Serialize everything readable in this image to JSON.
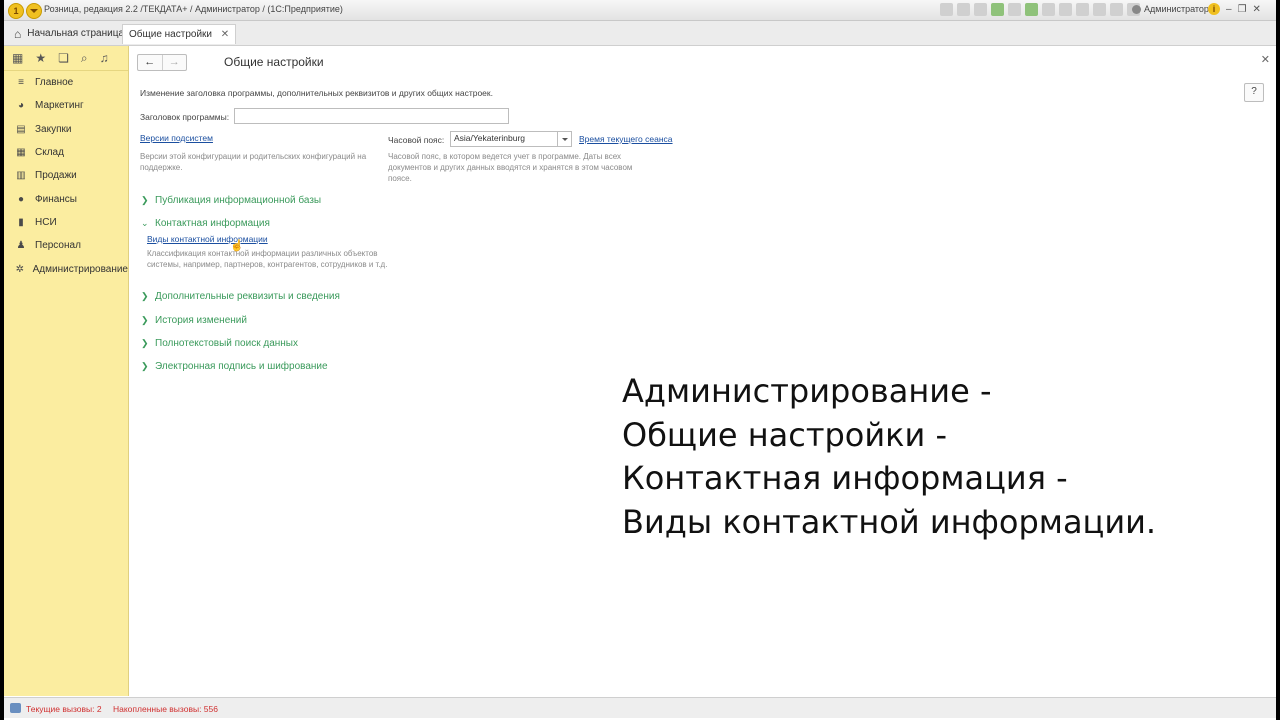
{
  "window": {
    "title": "Розница, редакция 2.2 /ТЕКДАТА+ / Администратор /  (1С:Предприятие)",
    "user": "Администратор"
  },
  "tabs": {
    "home": "Начальная страница",
    "active": "Общие настройки"
  },
  "sidebar": {
    "items": [
      {
        "label": "Главное",
        "icon": "menu-icon"
      },
      {
        "label": "Маркетинг",
        "icon": "pie-chart-icon"
      },
      {
        "label": "Закупки",
        "icon": "purchase-icon"
      },
      {
        "label": "Склад",
        "icon": "warehouse-icon"
      },
      {
        "label": "Продажи",
        "icon": "cart-icon"
      },
      {
        "label": "Финансы",
        "icon": "coin-icon"
      },
      {
        "label": "НСИ",
        "icon": "book-icon"
      },
      {
        "label": "Персонал",
        "icon": "person-icon"
      },
      {
        "label": "Администрирование",
        "icon": "gear-icon"
      }
    ]
  },
  "page": {
    "title": "Общие настройки",
    "description": "Изменение заголовка программы, дополнительных реквизитов и других общих настроек.",
    "program_title_label": "Заголовок программы:",
    "program_title_value": "",
    "versions_link": "Версии подсистем",
    "versions_hint": "Версии этой конфигурации и родительских конфигураций на поддержке.",
    "timezone_label": "Часовой пояс:",
    "timezone_value": "Asia/Yekaterinburg",
    "session_time_link": "Время текущего сеанса",
    "timezone_hint": "Часовой пояс, в котором ведется учет в программе. Даты всех документов и других данных вводятся и хранятся в этом часовом поясе.",
    "help": "?"
  },
  "groups": [
    {
      "label": "Публикация информационной базы",
      "expanded": false
    },
    {
      "label": "Контактная информация",
      "expanded": true
    },
    {
      "label": "Дополнительные реквизиты и сведения",
      "expanded": false
    },
    {
      "label": "История изменений",
      "expanded": false
    },
    {
      "label": "Полнотекстовый поиск данных",
      "expanded": false
    },
    {
      "label": "Электронная подпись и шифрование",
      "expanded": false
    }
  ],
  "contact_info": {
    "link": "Виды контактной информации",
    "hint": "Классификация контактной информации различных объектов системы, например, партнеров, контрагентов, сотрудников и т.д."
  },
  "caption": {
    "line1": "Администрирование -",
    "line2": "Общие настройки -",
    "line3": "Контактная информация -",
    "line4": "Виды контактной информации."
  },
  "status": {
    "current_calls": "Текущие вызовы: 2",
    "accumulated_calls": "Накопленные вызовы: 556"
  },
  "colors": {
    "sidebar_bg": "#fbeda0",
    "group_green": "#3a9a5b",
    "link_blue": "#1b4fa0",
    "status_red": "#d03030"
  }
}
